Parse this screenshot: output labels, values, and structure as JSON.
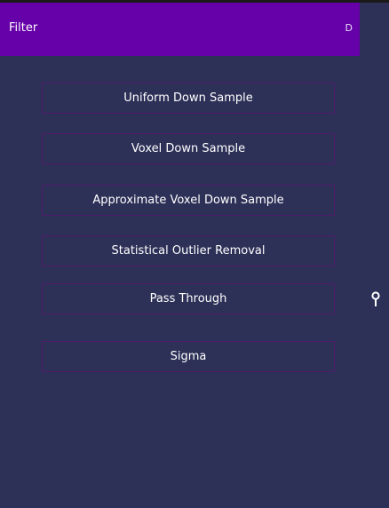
{
  "header": {
    "title": "Filter",
    "right_label": "D"
  },
  "buttons": [
    {
      "label": "Uniform Down Sample"
    },
    {
      "label": "Voxel Down Sample"
    },
    {
      "label": "Approximate Voxel Down Sample"
    },
    {
      "label": "Statistical Outlier Removal"
    },
    {
      "label": "Pass Through"
    },
    {
      "label": "Sigma"
    }
  ],
  "side": {
    "icon": "pin-icon"
  },
  "colors": {
    "background": "#2d3057",
    "header": "#6600a8",
    "button_border": "#4e1a6a",
    "text": "#ffffff"
  }
}
